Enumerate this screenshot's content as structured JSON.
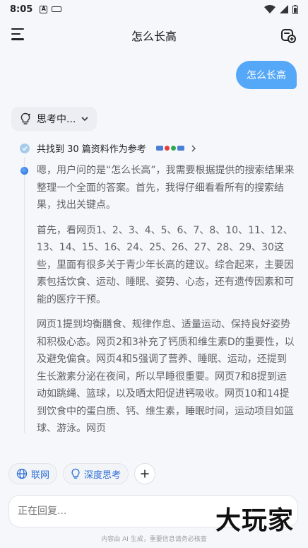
{
  "status_bar": {
    "time": "8:05"
  },
  "header": {
    "title": "怎么长高"
  },
  "conversation": {
    "user_message": "怎么长高",
    "thinking_label": "思考中...",
    "sources_text": "共找到 30 篇资料作为参考",
    "reasoning_paragraphs": [
      "嗯，用户问的是“怎么长高”，我需要根据提供的搜索结果来整理一个全面的答案。首先，我得仔细看看所有的搜索结果，找出关键点。",
      "首先，看网页1、2、3、4、5、6、7、8、10、11、12、13、14、15、16、24、25、26、27、28、29、30这些，里面有很多关于青少年长高的建议。综合起来，主要因素包括饮食、运动、睡眠、姿势、心态，还有遗传因素和可能的医疗干预。",
      "网页1提到均衡膳食、规律作息、适量运动、保持良好姿势和积极心态。网页2和3补充了钙质和维生素D的重要性，以及避免偏食。网页4和5强调了营养、睡眠、运动，还提到生长激素分泌在夜间，所以早睡很重要。网页7和8提到运动如跳绳、篮球，以及晒太阳促进钙吸收。网页10和14提到饮食中的蛋白质、钙、维生素，睡眠时间，运动项目如篮球、游泳。网页"
    ]
  },
  "chips": {
    "web": "联网",
    "deep_think": "深度思考"
  },
  "input": {
    "placeholder": "正在回复..."
  },
  "watermark": "大玩家",
  "footer": {
    "disclaimer": "内容由 AI 生成，重要信息请务必核查"
  },
  "colors": {
    "accent": "#55a7f7",
    "link": "#2e6fd6"
  }
}
